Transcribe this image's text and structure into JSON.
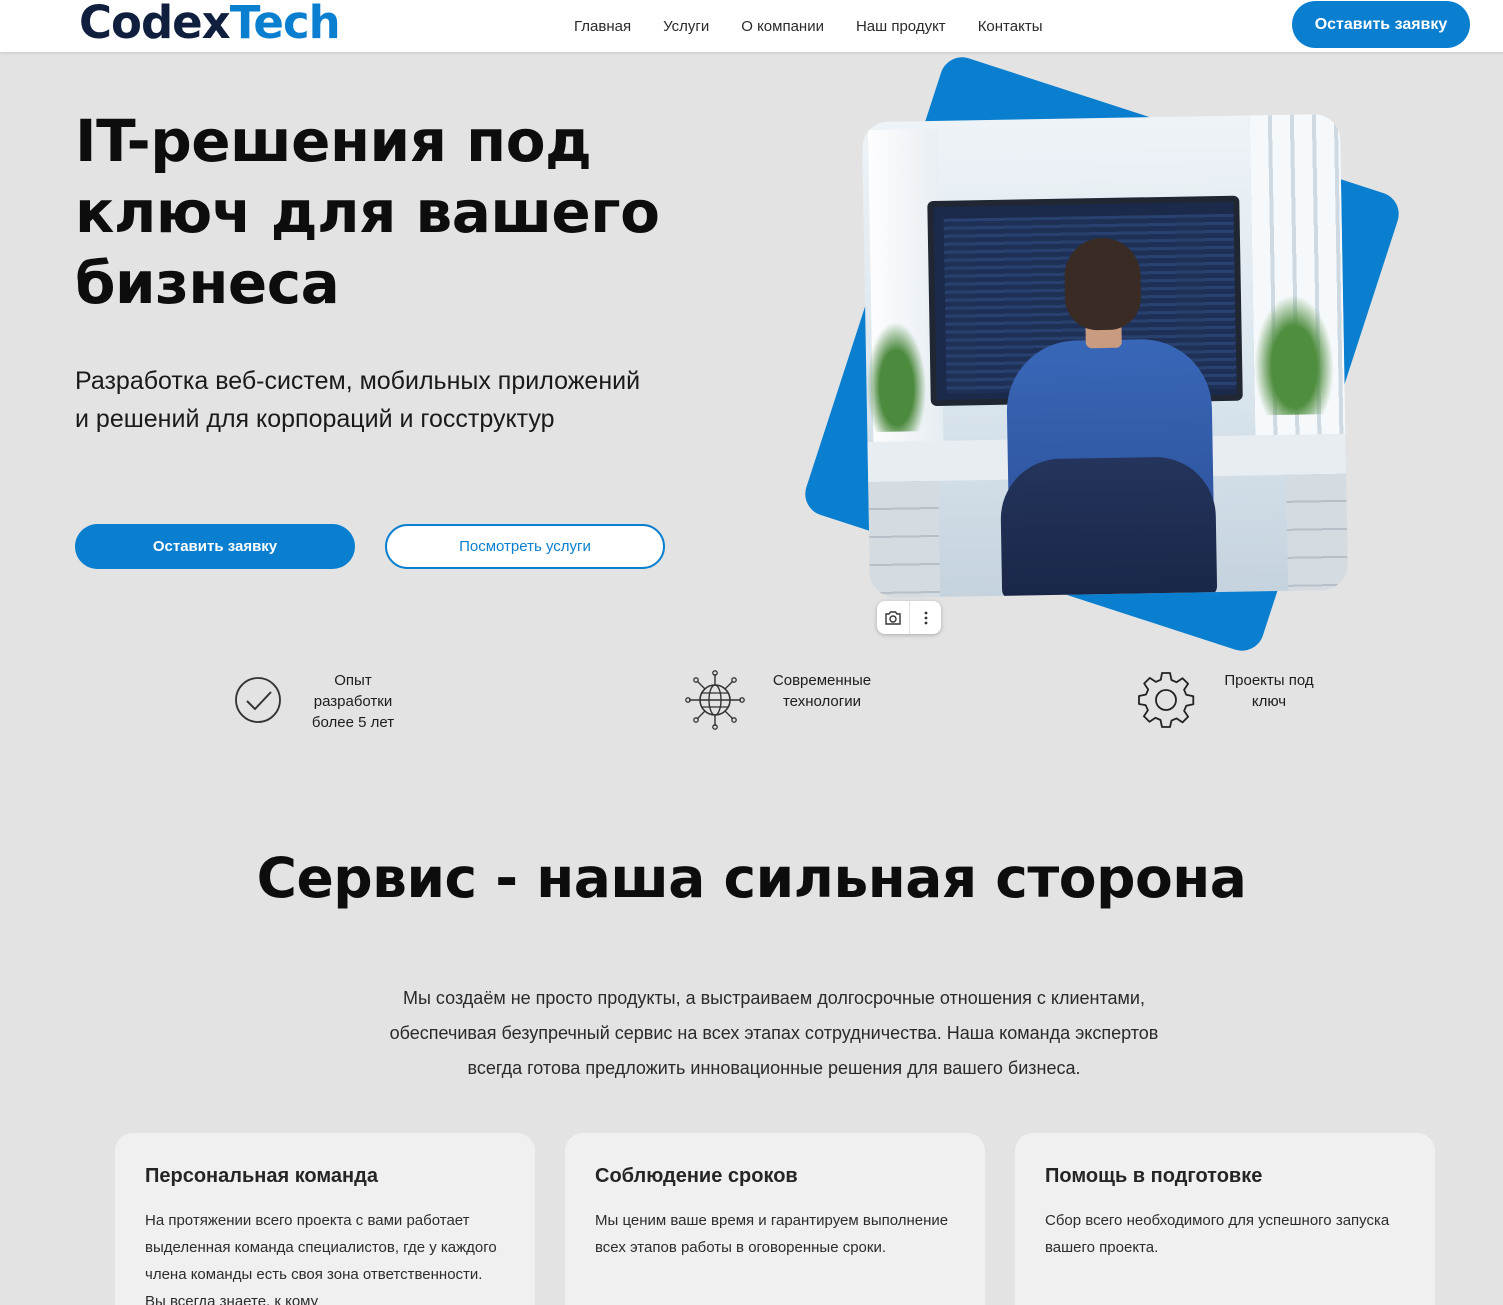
{
  "header": {
    "logo_part1": "Codex",
    "logo_part2": "Tech",
    "nav": [
      "Главная",
      "Услуги",
      "О компании",
      "Наш продукт",
      "Контакты"
    ],
    "cta_label": "Оставить заявку"
  },
  "hero": {
    "title": "IT-решения под ключ для вашего бизнеса",
    "subtitle": "Разработка веб-систем, мобильных приложений и решений для корпораций и госструктур",
    "primary_button": "Оставить заявку",
    "secondary_button": "Посмотреть услуги"
  },
  "features": [
    {
      "icon": "check-circle-icon",
      "text": "Опыт разработки более 5 лет"
    },
    {
      "icon": "globe-circuit-icon",
      "text": "Современные технологии"
    },
    {
      "icon": "gear-icon",
      "text": "Проекты под ключ"
    }
  ],
  "service_section": {
    "title": "Сервис - наша сильная сторона",
    "text": "Мы создаём не просто продукты, а выстраиваем долгосрочные отношения с клиентами, обеспечивая безупречный сервис на всех этапах сотрудничества. Наша команда экспертов всегда готова предложить инновационные решения для вашего бизнеса.",
    "cards": [
      {
        "title": "Персональная команда",
        "text": "На протяжении всего проекта с вами работает выделенная команда специалистов, где у каждого члена команды есть своя зона ответственности. Вы всегда знаете, к кому"
      },
      {
        "title": "Соблюдение сроков",
        "text": "Мы ценим ваше время и гарантируем выполнение всех этапов работы в оговоренные сроки."
      },
      {
        "title": "Помощь в подготовке",
        "text": "Сбор всего необходимого для успешного запуска вашего проекта."
      }
    ]
  },
  "colors": {
    "accent": "#0a7fd0",
    "background": "#e3e3e3",
    "logo_dark": "#0f1f3d"
  }
}
